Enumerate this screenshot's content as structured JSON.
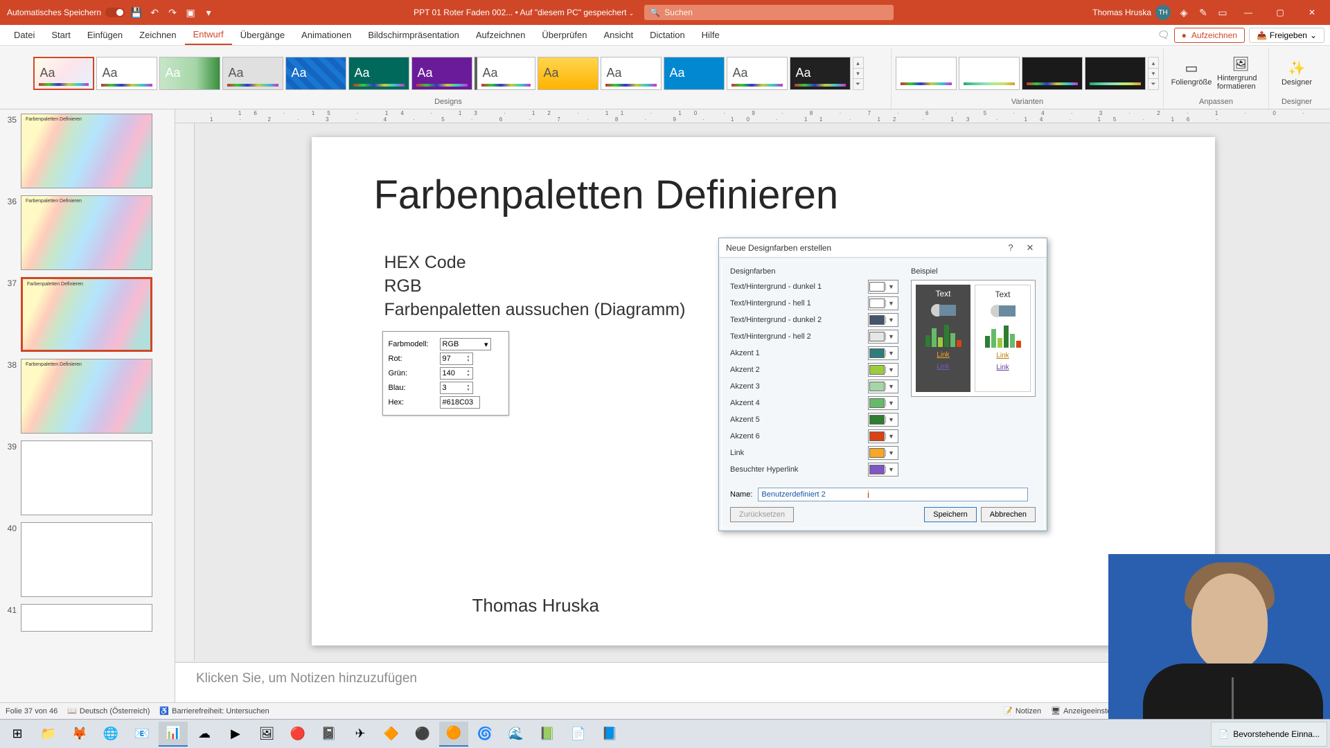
{
  "titlebar": {
    "auto_save": "Automatisches Speichern",
    "doc_name": "PPT 01 Roter Faden 002...",
    "saved_loc": "• Auf \"diesem PC\" gespeichert",
    "search_placeholder": "Suchen",
    "user_name": "Thomas Hruska",
    "user_initials": "TH"
  },
  "tabs": {
    "items": [
      "Datei",
      "Start",
      "Einfügen",
      "Zeichnen",
      "Entwurf",
      "Übergänge",
      "Animationen",
      "Bildschirmpräsentation",
      "Aufzeichnen",
      "Überprüfen",
      "Ansicht",
      "Dictation",
      "Hilfe"
    ],
    "active": "Entwurf",
    "record": "Aufzeichnen",
    "share": "Freigeben"
  },
  "ribbon": {
    "group_designs": "Designs",
    "group_variants": "Varianten",
    "group_adjust": "Anpassen",
    "group_designer": "Designer",
    "btn_slide_size": "Foliengröße",
    "btn_bg_format": "Hintergrund formatieren",
    "btn_designer": "Designer",
    "aa": "Aa"
  },
  "thumbs": {
    "nums": [
      "35",
      "36",
      "37",
      "38",
      "39",
      "40",
      "41"
    ],
    "t35": "Farbenpaletten Definieren",
    "t36": "Farbenpaletten Definieren",
    "t37": "Farbenpaletten Definieren",
    "t38": "Farbenpaletten Definieren"
  },
  "slide": {
    "title": "Farbenpaletten Definieren",
    "b1": "HEX Code",
    "b2": "RGB",
    "b3": "Farbenpaletten aussuchen (Diagramm)",
    "author": "Thomas Hruska",
    "cp_model_label": "Farbmodell:",
    "cp_model_value": "RGB",
    "cp_r_label": "Rot:",
    "cp_r_value": "97",
    "cp_g_label": "Grün:",
    "cp_g_value": "140",
    "cp_b_label": "Blau:",
    "cp_b_value": "3",
    "cp_hex_label": "Hex:",
    "cp_hex_value": "#618C03"
  },
  "notes": {
    "placeholder": "Klicken Sie, um Notizen hinzuzufügen"
  },
  "dialog": {
    "title": "Neue Designfarben erstellen",
    "section_colors": "Designfarben",
    "section_preview": "Beispiel",
    "rows": {
      "r1": "Text/Hintergrund - dunkel 1",
      "r2": "Text/Hintergrund - hell 1",
      "r3": "Text/Hintergrund - dunkel 2",
      "r4": "Text/Hintergrund - hell 2",
      "r5": "Akzent 1",
      "r6": "Akzent 2",
      "r7": "Akzent 3",
      "r8": "Akzent 4",
      "r9": "Akzent 5",
      "r10": "Akzent 6",
      "r11": "Link",
      "r12": "Besuchter Hyperlink"
    },
    "colors": {
      "c1": "#1f1f1f",
      "c2": "#ffffff",
      "c3": "#44546a",
      "c4": "#e7e6e6",
      "c5": "#2e7d7d",
      "c6": "#9ccc3c",
      "c7": "#a5d6a7",
      "c8": "#66bb6a",
      "c9": "#2e7d32",
      "c10": "#d84315",
      "c11": "#f9a825",
      "c12": "#7e57c2"
    },
    "preview_text": "Text",
    "preview_link": "Link",
    "name_label": "Name:",
    "name_value": "Benutzerdefiniert 2",
    "btn_reset": "Zurücksetzen",
    "btn_save": "Speichern",
    "btn_cancel": "Abbrechen"
  },
  "statusbar": {
    "slide_info": "Folie 37 von 46",
    "language": "Deutsch (Österreich)",
    "accessibility": "Barrierefreiheit: Untersuchen",
    "notes": "Notizen",
    "display": "Anzeigeeinstellungen"
  },
  "taskbar": {
    "task1": "Bevorstehende Einna..."
  }
}
